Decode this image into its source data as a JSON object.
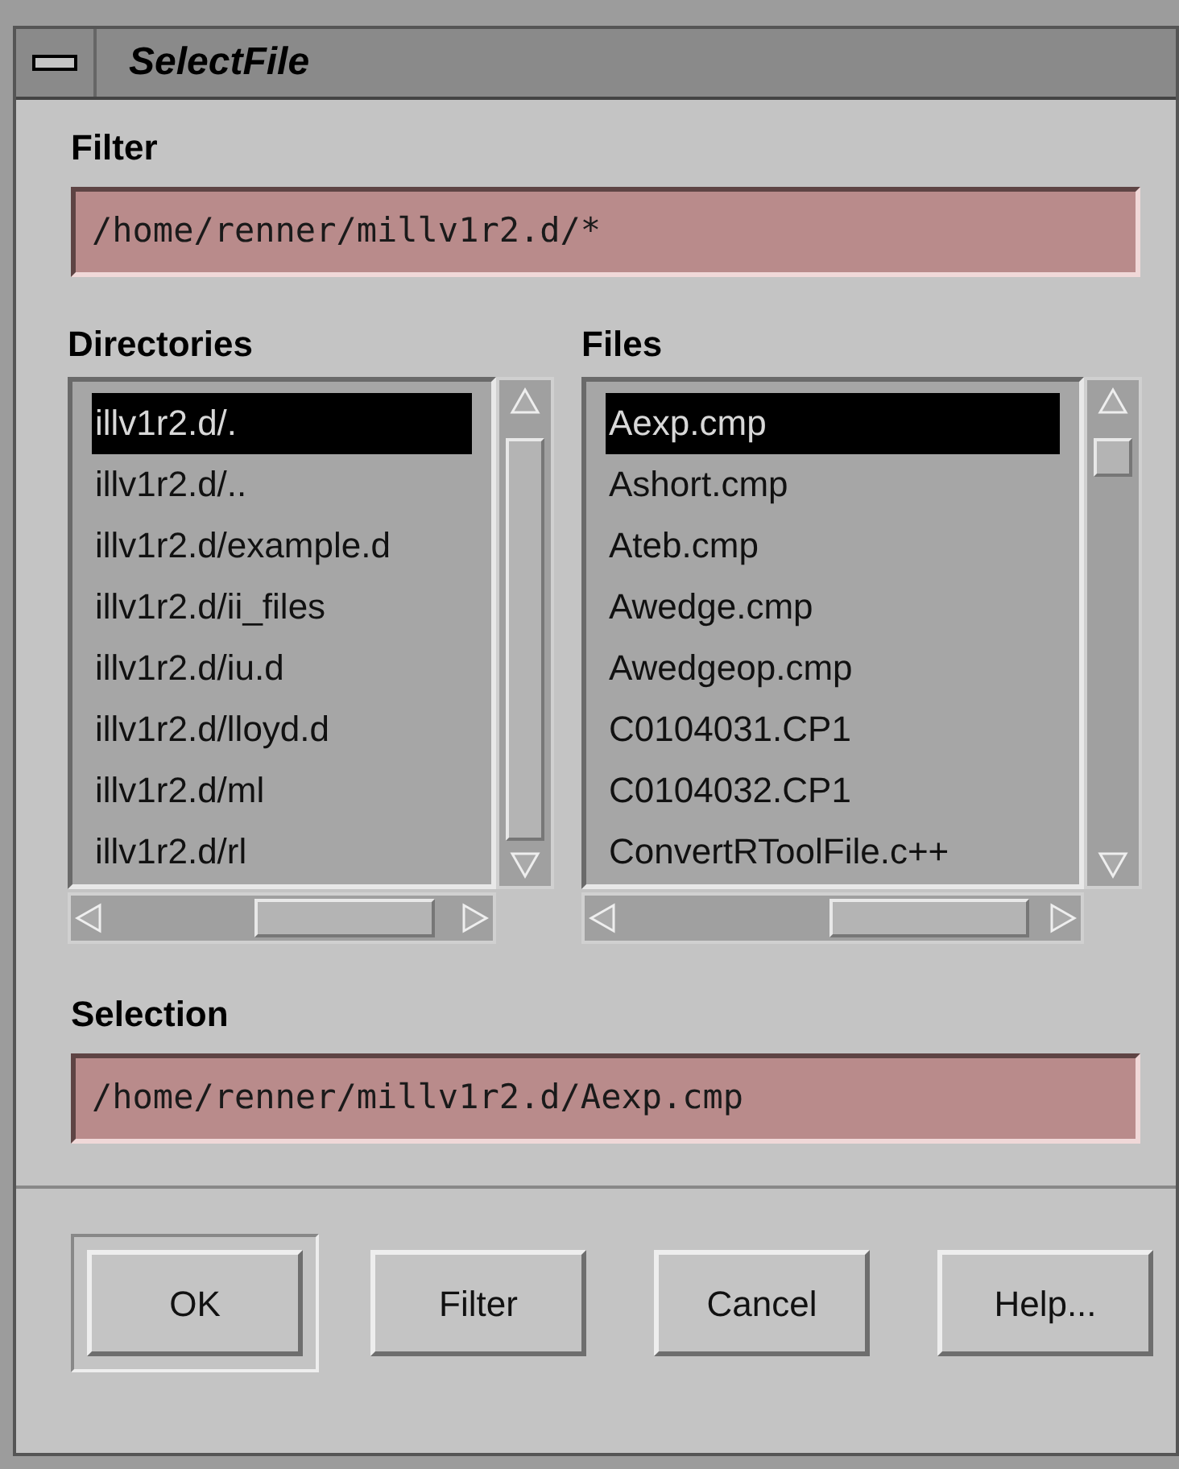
{
  "window": {
    "title": "SelectFile"
  },
  "filter": {
    "label": "Filter",
    "value": "/home/renner/millv1r2.d/*"
  },
  "directories": {
    "label": "Directories",
    "items": [
      {
        "text": "illv1r2.d/.",
        "selected": true
      },
      {
        "text": "illv1r2.d/..",
        "selected": false
      },
      {
        "text": "illv1r2.d/example.d",
        "selected": false
      },
      {
        "text": "illv1r2.d/ii_files",
        "selected": false
      },
      {
        "text": "illv1r2.d/iu.d",
        "selected": false
      },
      {
        "text": "illv1r2.d/lloyd.d",
        "selected": false
      },
      {
        "text": "illv1r2.d/ml",
        "selected": false
      },
      {
        "text": "illv1r2.d/rl",
        "selected": false
      }
    ]
  },
  "files": {
    "label": "Files",
    "items": [
      {
        "text": "Aexp.cmp",
        "selected": true
      },
      {
        "text": "Ashort.cmp",
        "selected": false
      },
      {
        "text": "Ateb.cmp",
        "selected": false
      },
      {
        "text": "Awedge.cmp",
        "selected": false
      },
      {
        "text": "Awedgeop.cmp",
        "selected": false
      },
      {
        "text": "C0104031.CP1",
        "selected": false
      },
      {
        "text": "C0104032.CP1",
        "selected": false
      },
      {
        "text": "ConvertRToolFile.c++",
        "selected": false
      }
    ]
  },
  "selection": {
    "label": "Selection",
    "value": "/home/renner/millv1r2.d/Aexp.cmp"
  },
  "buttons": [
    {
      "label": "OK",
      "default": true
    },
    {
      "label": "Filter",
      "default": false
    },
    {
      "label": "Cancel",
      "default": false
    },
    {
      "label": "Help...",
      "default": false
    }
  ]
}
